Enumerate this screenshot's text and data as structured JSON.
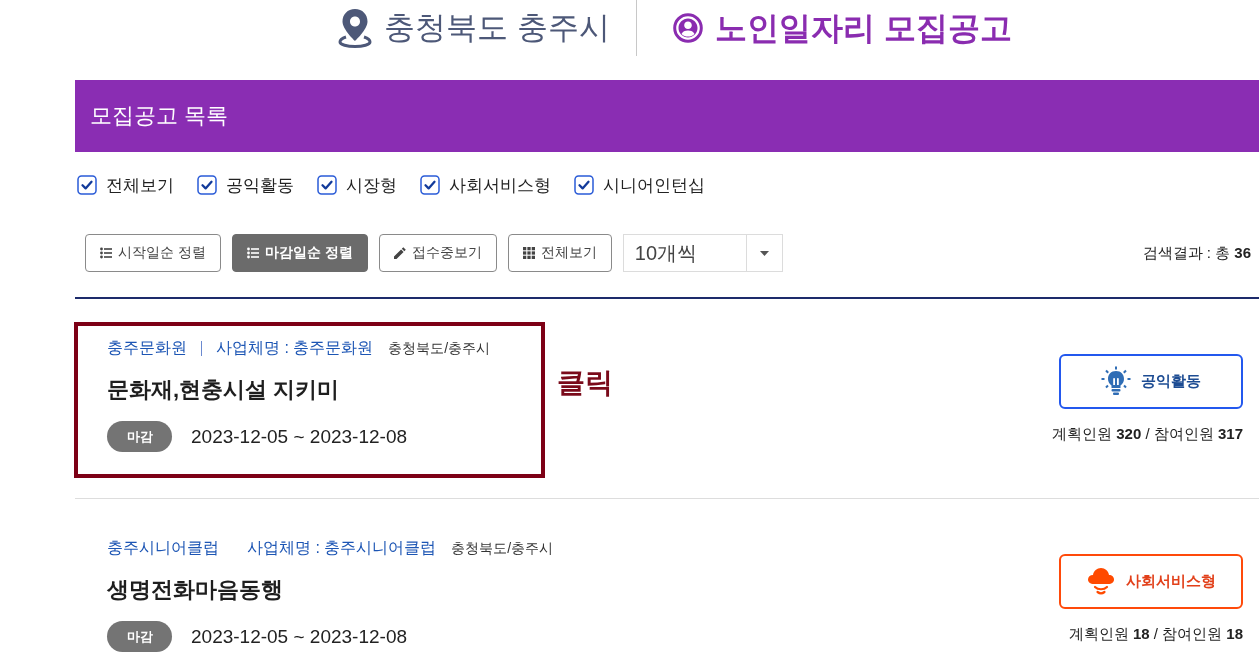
{
  "header": {
    "location": "충청북도 충주시",
    "title": "노인일자리 모집공고"
  },
  "list_panel": {
    "title": "모집공고 목록"
  },
  "filters": [
    {
      "label": "전체보기",
      "checked": true
    },
    {
      "label": "공익활동",
      "checked": true
    },
    {
      "label": "시장형",
      "checked": true
    },
    {
      "label": "사회서비스형",
      "checked": true
    },
    {
      "label": "시니어인턴십",
      "checked": true
    }
  ],
  "toolbar": {
    "buttons": [
      {
        "label": "시작일순 정렬",
        "kind": "sort",
        "selected": false
      },
      {
        "label": "마감일순 정렬",
        "kind": "sort",
        "selected": true
      },
      {
        "label": "접수중보기",
        "kind": "edit",
        "selected": false
      },
      {
        "label": "전체보기",
        "kind": "grid",
        "selected": false
      }
    ],
    "page_size": {
      "value": "10개씩"
    },
    "result": "검색결과 : 총 **36**"
  },
  "items": [
    {
      "organization": "충주문화원",
      "business_name": "사업체명 : 충주문화원",
      "region": "충청북도/충주시",
      "title": "문화재,현충시설 지키미",
      "status": "마감",
      "period": "2023-12-05 ~ 2023-12-08",
      "category": {
        "label": "공익활동",
        "kind": "public"
      },
      "counts": "계획인원 **320** / 참여인원 **317**",
      "highlighted": true,
      "callout": "클릭"
    },
    {
      "organization": "충주시니어클럽",
      "business_name": "사업체명 : 충주시니어클럽",
      "region": "충청북도/충주시",
      "title": "생명전화마음동행",
      "status": "마감",
      "period": "2023-12-05 ~ 2023-12-08",
      "category": {
        "label": "사회서비스형",
        "kind": "social"
      },
      "counts": "계획인원 **18** / 참여인원 **18**",
      "highlighted": false
    }
  ]
}
